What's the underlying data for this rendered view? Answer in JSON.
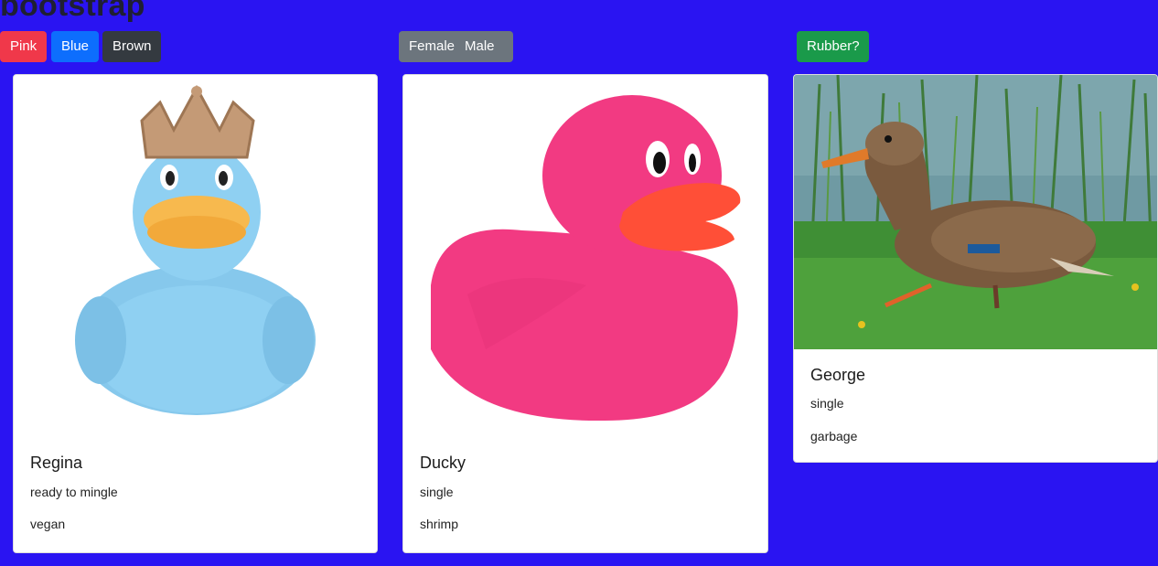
{
  "page": {
    "title": "bootstrap"
  },
  "filters": {
    "color": [
      {
        "label": "Pink",
        "color": "#f0384a"
      },
      {
        "label": "Blue",
        "color": "#0d6efd"
      },
      {
        "label": "Brown",
        "color": "#343a40"
      }
    ],
    "gender": [
      {
        "label": "Female",
        "color": "#6c757d"
      },
      {
        "label": "Male",
        "color": "#6c757d"
      }
    ],
    "rubber": {
      "label": "Rubber?",
      "color": "#1a9a4a"
    }
  },
  "cards": [
    {
      "name": "Regina",
      "status": "ready to mingle",
      "diet": "vegan",
      "image": "blue-crowned-rubber-duck"
    },
    {
      "name": "Ducky",
      "status": "single",
      "diet": "shrimp",
      "image": "pink-rubber-duck"
    },
    {
      "name": "George",
      "status": "single",
      "diet": "garbage",
      "image": "mallard-duck-photo"
    }
  ]
}
